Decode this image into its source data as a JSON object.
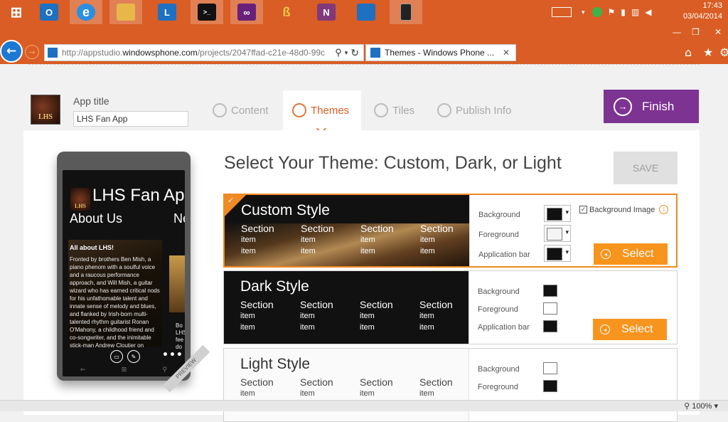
{
  "taskbar": {
    "apps": [
      {
        "name": "windows-icon",
        "glyph": "⊞",
        "color": "#d95d24"
      },
      {
        "name": "outlook-icon",
        "glyph": "O",
        "color": "#1e70c1"
      },
      {
        "name": "internet-explorer-icon",
        "glyph": "e",
        "color": "#2b8fe0"
      },
      {
        "name": "file-explorer-icon",
        "glyph": "▤",
        "color": "#e8b74a"
      },
      {
        "name": "lync-icon",
        "glyph": "L",
        "color": "#1e70c1"
      },
      {
        "name": "command-prompt-icon",
        "glyph": ">_",
        "color": "#111111"
      },
      {
        "name": "visual-studio-icon",
        "glyph": "∞",
        "color": "#68217a"
      },
      {
        "name": "blend-icon",
        "glyph": "b",
        "color": "#d95d24"
      },
      {
        "name": "onenote-icon",
        "glyph": "N",
        "color": "#80397b"
      },
      {
        "name": "remote-desktop-icon",
        "glyph": "▭",
        "color": "#1e70c1"
      },
      {
        "name": "phone-emulator-icon",
        "glyph": "▯",
        "color": "#222222"
      }
    ],
    "time": "17:43",
    "date": "03/04/2014"
  },
  "browser": {
    "url_prefix": "http://appstudio.",
    "url_domain": "windowsphone.com",
    "url_rest": "/projects/2047ffad-c21e-48d0-99c",
    "tab_title": "Themes - Windows Phone ...",
    "zoom": "100%"
  },
  "app": {
    "title_label": "App title",
    "title_value": "LHS Fan App",
    "logo_text": "LHS"
  },
  "nav": {
    "tabs": [
      {
        "label": "Content"
      },
      {
        "label": "Themes"
      },
      {
        "label": "Tiles"
      },
      {
        "label": "Publish Info"
      }
    ],
    "finish": "Finish"
  },
  "phone": {
    "app_title": "LHS Fan App",
    "section": "About Us",
    "section_next": "Ne",
    "subhead": "All about LHS!",
    "body": "Fronted by brothers Ben Mish, a piano phenom with a soulful voice and a raucous performance approach, and Will Mish, a guitar wizard who has earned critical nods for his unfathomable talent and innate sense of melody and blues, and flanked by Irish-born multi-talented rhythm guitarist Ronan O'Mahony, a childhood friend and co-songwriter, and the inimitable stick-man Andrew Cloutier on drums, Left Hand Freakin brings a blend of",
    "side_text": "Bo LHS fee do",
    "preview": "PREVIEW"
  },
  "themes": {
    "heading": "Select Your Theme: Custom, Dark, or Light",
    "save": "SAVE",
    "section_label": "Section",
    "item_label": "item",
    "labels": {
      "background": "Background",
      "foreground": "Foreground",
      "appbar": "Application bar",
      "bgimage": "Background Image",
      "select": "Select"
    },
    "items": [
      {
        "name": "Custom Style",
        "selected": true,
        "bg": "#111111",
        "fg": "#f4f4f4",
        "appbar": "#111111"
      },
      {
        "name": "Dark Style",
        "selected": false,
        "bg": "#111111",
        "fg": "#ffffff",
        "appbar": "#111111"
      },
      {
        "name": "Light Style",
        "selected": false,
        "bg": "#ffffff",
        "fg": "#111111",
        "appbar": "#111111"
      }
    ]
  },
  "colors": {
    "accent": "#d95d24",
    "select": "#f7941d",
    "finish": "#7d3392"
  }
}
